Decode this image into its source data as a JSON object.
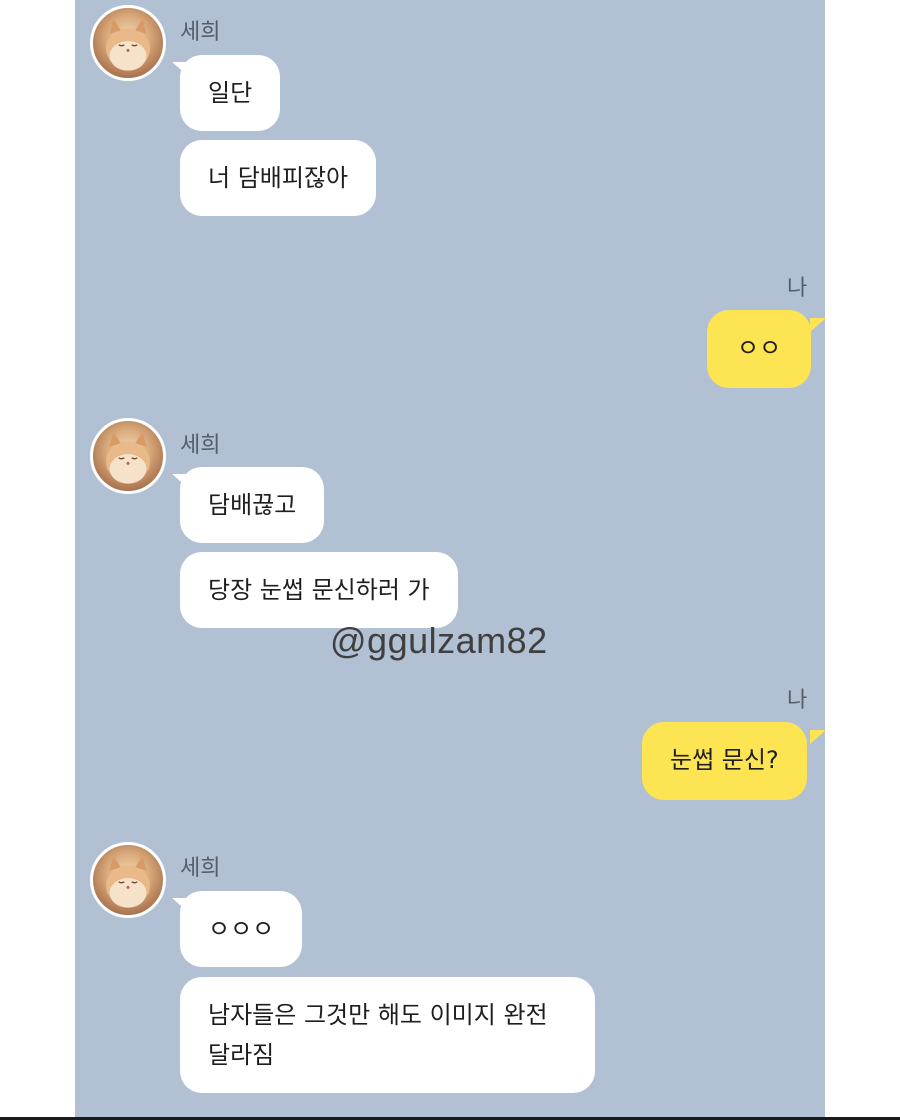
{
  "contacts": {
    "other_name": "세희",
    "me_label": "나"
  },
  "messages": [
    {
      "side": "in",
      "text": "일단"
    },
    {
      "side": "in",
      "text": "너 담배피잖아"
    },
    {
      "side": "out",
      "text": "ㅇㅇ"
    },
    {
      "side": "in",
      "text": "담배끊고"
    },
    {
      "side": "in",
      "text": "당장 눈썹 문신하러 가"
    },
    {
      "side": "out",
      "text": "눈썹 문신?"
    },
    {
      "side": "in",
      "text": "ㅇㅇㅇ"
    },
    {
      "side": "in",
      "text": "남자들은 그것만 해도 이미지 완전 달라짐"
    }
  ],
  "watermark": "@ggulzam82",
  "colors": {
    "background": "#b2c0d3",
    "incoming_bubble": "#ffffff",
    "outgoing_bubble": "#fde452"
  },
  "icons": {
    "avatar": "cat-avatar-icon"
  }
}
